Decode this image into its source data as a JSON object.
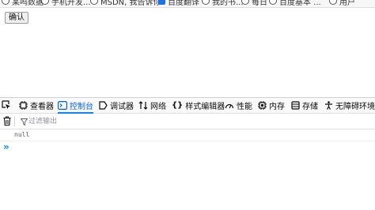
{
  "bookmarks": [
    {
      "label": "某鸣数据",
      "icon": "globe-icon"
    },
    {
      "label": "手机开发...",
      "icon": "globe-icon"
    },
    {
      "label": "MSDN, 我告诉你",
      "icon": "globe-icon"
    },
    {
      "label": "百度翻译",
      "icon": "translate-icon"
    },
    {
      "label": "我的书...",
      "icon": "globe-icon"
    },
    {
      "label": "每日",
      "icon": "globe-icon"
    },
    {
      "label": "百度基本 ...",
      "icon": "globe-icon"
    },
    {
      "label": "用户",
      "icon": "globe-icon"
    }
  ],
  "page": {
    "confirm_button": "确认"
  },
  "devtools": {
    "tabs": [
      {
        "label": "查看器",
        "icon": "inspector-icon"
      },
      {
        "label": "控制台",
        "icon": "console-icon",
        "active": true
      },
      {
        "label": "调试器",
        "icon": "debugger-icon"
      },
      {
        "label": "网络",
        "icon": "network-icon"
      },
      {
        "label": "样式编辑器",
        "icon": "style-editor-icon"
      },
      {
        "label": "性能",
        "icon": "performance-icon"
      },
      {
        "label": "内存",
        "icon": "memory-icon"
      },
      {
        "label": "存储",
        "icon": "storage-icon"
      },
      {
        "label": "无障碍环境",
        "icon": "accessibility-icon"
      }
    ],
    "filter_placeholder": "过滤输出",
    "log_output": "null",
    "prompt_symbol": "»",
    "accent_color": "#0a84ff"
  }
}
